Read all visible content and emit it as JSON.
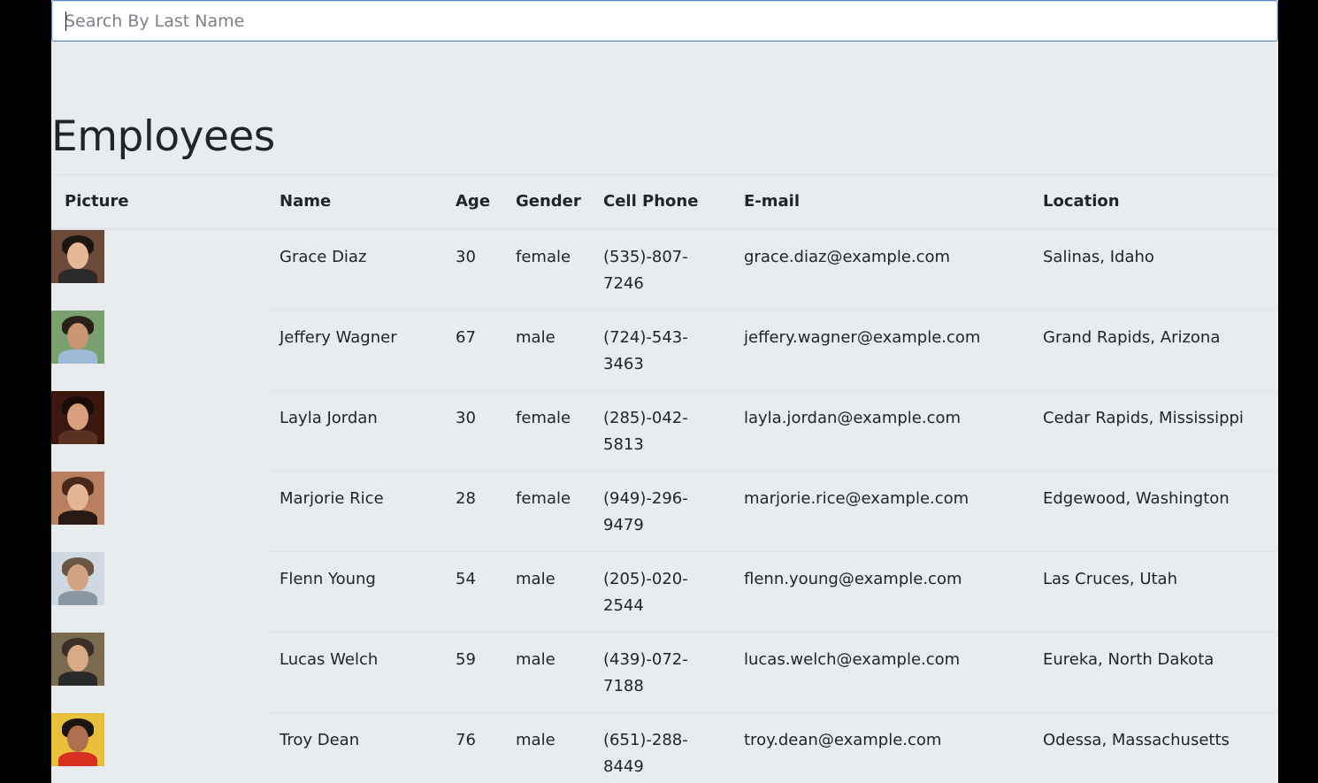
{
  "search": {
    "placeholder": "Search By Last Name",
    "value": ""
  },
  "page_title": "Employees",
  "table": {
    "headers": [
      "Picture",
      "Name",
      "Age",
      "Gender",
      "Cell Phone",
      "E-mail",
      "Location"
    ],
    "rows": [
      {
        "avatar_colors": [
          "#6b4a3a",
          "#e6b89a",
          "#1e1410",
          "#2a2a2a"
        ],
        "name": "Grace Diaz",
        "age": "30",
        "gender": "female",
        "phone1": "(535)-807-",
        "phone2": "7246",
        "email": "grace.diaz@example.com",
        "location": "Salinas, Idaho"
      },
      {
        "avatar_colors": [
          "#7aa070",
          "#c89670",
          "#2b2018",
          "#9fb8d6"
        ],
        "name": "Jeffery Wagner",
        "age": "67",
        "gender": "male",
        "phone1": "(724)-543-",
        "phone2": "3463",
        "email": "jeffery.wagner@example.com",
        "location": "Grand Rapids, Arizona"
      },
      {
        "avatar_colors": [
          "#3a1810",
          "#d9a080",
          "#1a0c08",
          "#5a3020"
        ],
        "name": "Layla Jordan",
        "age": "30",
        "gender": "female",
        "phone1": "(285)-042-",
        "phone2": "5813",
        "email": "layla.jordan@example.com",
        "location": "Cedar Rapids, Mississippi"
      },
      {
        "avatar_colors": [
          "#b88060",
          "#e2b594",
          "#4a2818",
          "#2a1a14"
        ],
        "name": "Marjorie Rice",
        "age": "28",
        "gender": "female",
        "phone1": "(949)-296-",
        "phone2": "9479",
        "email": "marjorie.rice@example.com",
        "location": "Edgewood, Washington"
      },
      {
        "avatar_colors": [
          "#cfd8e0",
          "#d2a484",
          "#6a5444",
          "#8a96a0"
        ],
        "name": "Flenn Young",
        "age": "54",
        "gender": "male",
        "phone1": "(205)-020-",
        "phone2": "2544",
        "email": "flenn.young@example.com",
        "location": "Las Cruces, Utah"
      },
      {
        "avatar_colors": [
          "#7a6a50",
          "#d8aa88",
          "#3a3026",
          "#2a2a2a"
        ],
        "name": "Lucas Welch",
        "age": "59",
        "gender": "male",
        "phone1": "(439)-072-",
        "phone2": "7188",
        "email": "lucas.welch@example.com",
        "location": "Eureka, North Dakota"
      },
      {
        "avatar_colors": [
          "#e8c03a",
          "#b07050",
          "#1c140e",
          "#d83020"
        ],
        "name": "Troy Dean",
        "age": "76",
        "gender": "male",
        "phone1": "(651)-288-",
        "phone2": "8449",
        "email": "troy.dean@example.com",
        "location": "Odessa, Massachusetts"
      }
    ]
  }
}
